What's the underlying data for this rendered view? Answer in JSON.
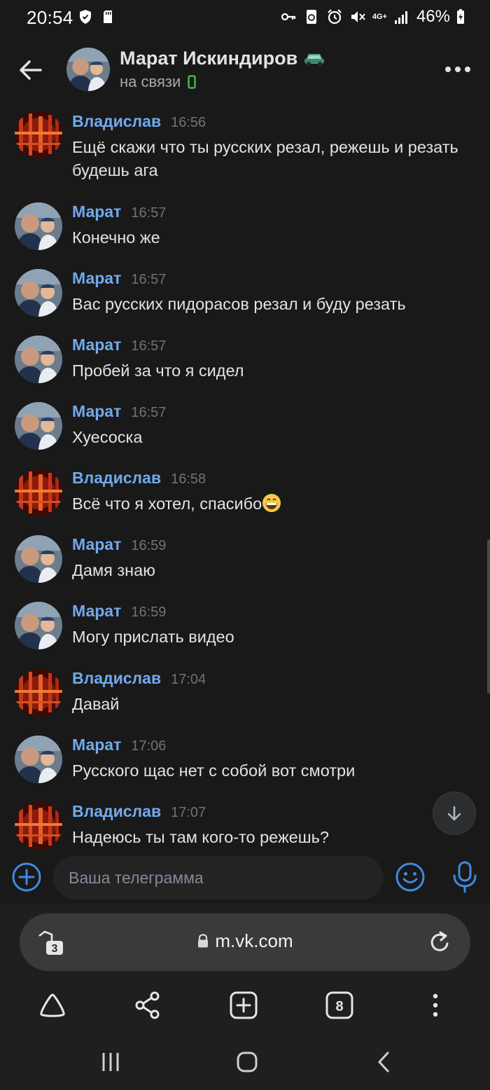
{
  "status_bar": {
    "time": "20:54",
    "network": "4G+",
    "battery": "46%"
  },
  "header": {
    "name": "Марат Искиндиров",
    "name_emoji": "car-icon",
    "status": "на связи",
    "status_icon": "mobile-online-icon"
  },
  "messages": [
    {
      "author": "Владислав",
      "time": "16:56",
      "text": "Ещё скажи что ты русских резал, режешь и резать будешь ага",
      "avatar": "vladislav"
    },
    {
      "author": "Марат",
      "time": "16:57",
      "text": "Конечно же",
      "avatar": "marat"
    },
    {
      "author": "Марат",
      "time": "16:57",
      "text": "Вас русских пидорасов резал и буду резать",
      "avatar": "marat"
    },
    {
      "author": "Марат",
      "time": "16:57",
      "text": "Пробей за что я сидел",
      "avatar": "marat"
    },
    {
      "author": "Марат",
      "time": "16:57",
      "text": "Хуесоска",
      "avatar": "marat"
    },
    {
      "author": "Владислав",
      "time": "16:58",
      "text": "Всё что я хотел, спасибо",
      "emoji": "grinning-face-icon",
      "avatar": "vladislav"
    },
    {
      "author": "Марат",
      "time": "16:59",
      "text": "Дамя знаю",
      "avatar": "marat"
    },
    {
      "author": "Марат",
      "time": "16:59",
      "text": "Могу прислать видео",
      "avatar": "marat"
    },
    {
      "author": "Владислав",
      "time": "17:04",
      "text": "Давай",
      "avatar": "vladislav"
    },
    {
      "author": "Марат",
      "time": "17:06",
      "text": "Русского щас нет с собой вот смотри",
      "avatar": "marat"
    },
    {
      "author": "Владислав",
      "time": "17:07",
      "text": "Надеюсь ты там кого-то режешь?",
      "avatar": "vladislav"
    }
  ],
  "composer": {
    "placeholder": "Ваша телеграмма"
  },
  "browser": {
    "url": "m.vk.com",
    "tab_badge": "3",
    "tabs_count": "8"
  },
  "colors": {
    "background": "#19191a",
    "accent": "#71aaeb",
    "icon_blue": "#3f8ae0",
    "text": "#e1e3e6",
    "muted": "#6f7378",
    "online_green": "#4bb34b"
  }
}
